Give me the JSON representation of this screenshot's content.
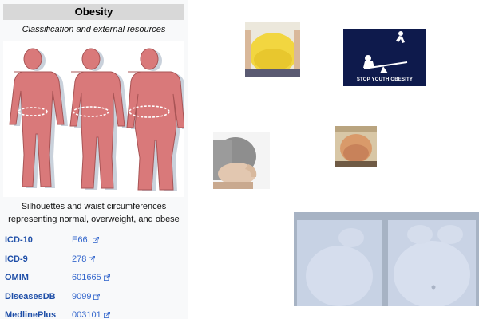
{
  "infobox": {
    "title": "Obesity",
    "subtitle": "Classification and external resources",
    "caption_line1": "Silhouettes and waist circumferences",
    "caption_line2": "representing normal, overweight, and obese",
    "rows": [
      {
        "key": "ICD-10",
        "value": "E66."
      },
      {
        "key": "ICD-9",
        "value": "278"
      },
      {
        "key": "OMIM",
        "value": "601665"
      },
      {
        "key": "DiseasesDB",
        "value": "9099"
      },
      {
        "key": "MedlinePlus",
        "value": "003101"
      }
    ]
  },
  "thumbnails": {
    "youth_poster_text": "STOP YOUTH OBESITY"
  },
  "colors": {
    "link": "#3366cc",
    "key_link": "#1f4fa8",
    "silhouette": "#d9797a",
    "poster_bg": "#0e1a4c"
  },
  "icons": [
    "external-link-icon"
  ]
}
